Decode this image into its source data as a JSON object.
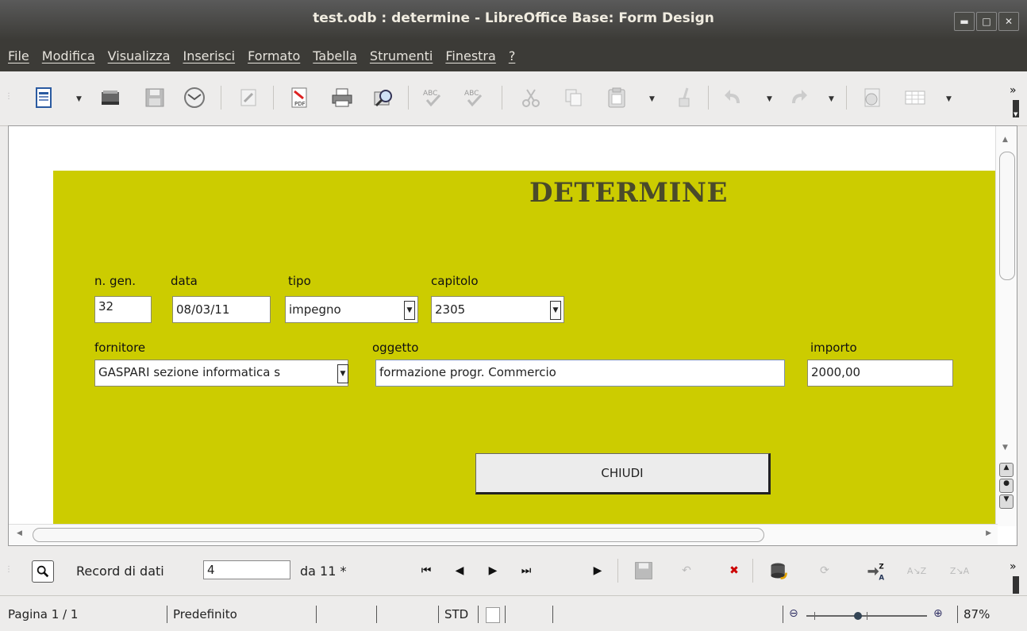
{
  "window": {
    "title": "test.odb : determine - LibreOffice Base: Form Design"
  },
  "menu": [
    "File",
    "Modifica",
    "Visualizza",
    "Inserisci",
    "Formato",
    "Tabella",
    "Strumenti",
    "Finestra",
    "?"
  ],
  "toolbar": {
    "icons": [
      "new-document-icon",
      "open-icon",
      "save-icon",
      "email-icon",
      "edit-mode-icon",
      "export-pdf-icon",
      "print-icon",
      "print-preview-icon",
      "spellcheck-icon",
      "autospellcheck-icon",
      "cut-icon",
      "copy-icon",
      "paste-icon",
      "format-paintbrush-icon",
      "undo-icon",
      "redo-icon",
      "navigator-icon",
      "table-icon"
    ]
  },
  "form": {
    "title": "DETERMINE",
    "labels": {
      "ngen": "n. gen.",
      "data": "data",
      "tipo": "tipo",
      "capitolo": "capitolo",
      "fornitore": "fornitore",
      "oggetto": "oggetto",
      "importo": "importo"
    },
    "values": {
      "ngen": "32",
      "data": "08/03/11",
      "tipo": "impegno",
      "capitolo": "2305",
      "fornitore": "GASPARI sezione informatica s",
      "oggetto": "formazione progr. Commercio",
      "importo": "2000,00"
    },
    "close_button": "CHIUDI"
  },
  "navigation": {
    "record_label": "Record di dati",
    "record_value": "4",
    "of_label": "da 11 *"
  },
  "status": {
    "page": "Pagina 1 / 1",
    "style": "Predefinito",
    "mode": "STD",
    "zoom": "87%",
    "zoom_level": 0.87
  },
  "colors": {
    "form_bg": "#cccc00",
    "title_color": "#4a4a2a"
  }
}
